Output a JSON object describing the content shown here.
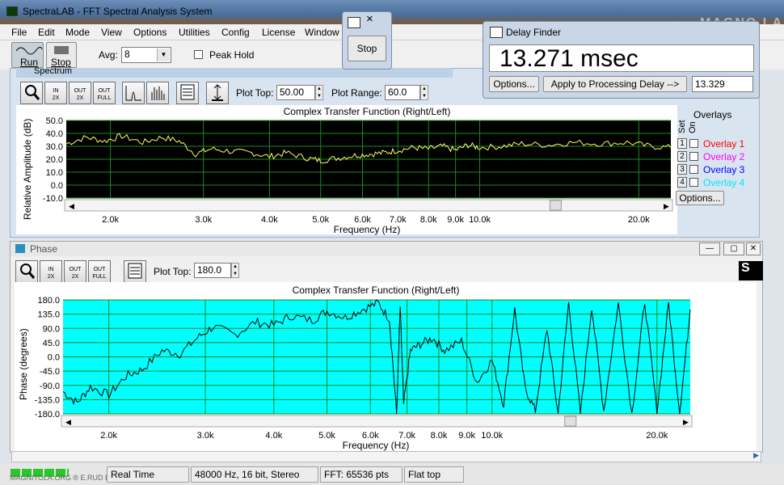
{
  "app": {
    "title": "SpectraLAB - FFT Spectral Analysis System",
    "brand_watermark": "MAGNO LA"
  },
  "menu": [
    "File",
    "Edit",
    "Mode",
    "View",
    "Options",
    "Utilities",
    "Config",
    "License",
    "Window"
  ],
  "toolbar": {
    "run_label": "Run",
    "stop_label": "Stop",
    "avg_label": "Avg:",
    "avg_value": "8",
    "peak_hold_label": "Peak Hold",
    "peak_hold_checked": false
  },
  "stop_dialog": {
    "button_label": "Stop",
    "close_glyph": "×"
  },
  "delay_finder": {
    "title": "Delay Finder",
    "value": "13.271 msec",
    "options_label": "Options...",
    "apply_label": "Apply to Processing Delay -->",
    "delay_value": "13.329"
  },
  "spectrum": {
    "window_title": "Spectrum",
    "plot_top_label": "Plot Top:",
    "plot_top_value": "50.00",
    "plot_range_label": "Plot Range:",
    "plot_range_value": "60.0",
    "tool_icons": [
      "zoom-icon",
      "zoom-in-2x-icon",
      "zoom-out-2x-icon",
      "zoom-out-full-icon",
      "peak-icon",
      "bars-icon",
      "table-icon",
      "autoscale-icon"
    ],
    "zoom_in_text": "IN\n2X",
    "zoom_out_text": "OUT\n2X",
    "zoom_full_text": "OUT\nFULL",
    "overlays_title": "Overlays",
    "set_label": "Set",
    "on_label": "On",
    "overlays": [
      {
        "num": "1",
        "label": "Overlay 1",
        "color": "#ff0000"
      },
      {
        "num": "2",
        "label": "Overlay 2",
        "color": "#ff00ff"
      },
      {
        "num": "3",
        "label": "Overlay 3",
        "color": "#0000ff"
      },
      {
        "num": "4",
        "label": "Overlay 4",
        "color": "#00e5ff"
      }
    ],
    "options_label": "Options..."
  },
  "phase": {
    "window_title": "Phase",
    "plot_top_label": "Plot Top:",
    "plot_top_value": "180.0",
    "tool_icons": [
      "zoom-icon",
      "zoom-in-2x-icon",
      "zoom-out-2x-icon",
      "zoom-out-full-icon",
      "table-icon"
    ],
    "zoom_in_text": "IN\n2X",
    "zoom_out_text": "OUT\n2X",
    "zoom_full_text": "OUT\nFULL",
    "side_glyph": "S"
  },
  "status": {
    "left_text": "MAGNITOLA.ORG ® E.RUD E.NET®",
    "mode": "Real Time",
    "format": "48000 Hz, 16 bit, Stereo",
    "fft": "FFT: 65536 pts",
    "window": "Flat top"
  },
  "chart_data": [
    {
      "type": "line",
      "title": "Complex Transfer Function (Right/Left)",
      "xlabel": "Frequency (Hz)",
      "ylabel": "Relative Amplitude (dB)",
      "x_scale": "log",
      "xlim": [
        1650,
        23000
      ],
      "ylim": [
        -10.0,
        50.0
      ],
      "y_ticks": [
        "50.0",
        "40.0",
        "30.0",
        "20.0",
        "10.0",
        "0.0",
        "-10.0"
      ],
      "x_ticks": [
        {
          "value": 2000,
          "label": "2.0k"
        },
        {
          "value": 3000,
          "label": "3.0k"
        },
        {
          "value": 4000,
          "label": "4.0k"
        },
        {
          "value": 5000,
          "label": "5.0k"
        },
        {
          "value": 6000,
          "label": "6.0k"
        },
        {
          "value": 7000,
          "label": "7.0k"
        },
        {
          "value": 8000,
          "label": "8.0k"
        },
        {
          "value": 9000,
          "label": "9.0k"
        },
        {
          "value": 10000,
          "label": "10.0k"
        },
        {
          "value": 20000,
          "label": "20.0k"
        }
      ],
      "grid": true,
      "background": "#000000",
      "grid_color": "#1e8a1e",
      "series": [
        {
          "color": "#ffff66",
          "x": [
            1650,
            1800,
            1950,
            2100,
            2300,
            2500,
            2700,
            2900,
            3100,
            3400,
            3700,
            4000,
            4300,
            4700,
            5000,
            5400,
            5800,
            6200,
            6600,
            7000,
            7500,
            8000,
            8500,
            9000,
            9500,
            10000,
            11000,
            12000,
            13500,
            15000,
            17000,
            19000,
            21000,
            23000
          ],
          "y": [
            32,
            37,
            34,
            38,
            33,
            37,
            34,
            24,
            28,
            26,
            25,
            22,
            25,
            21,
            19,
            21,
            23,
            24,
            25,
            27,
            29,
            28,
            30,
            27,
            31,
            29,
            30,
            32,
            31,
            33,
            32,
            33,
            30,
            29
          ]
        }
      ]
    },
    {
      "type": "line",
      "title": "Complex Transfer Function (Right/Left)",
      "xlabel": "Frequency (Hz)",
      "ylabel": "Phase (degrees)",
      "x_scale": "log",
      "xlim": [
        1650,
        23000
      ],
      "ylim": [
        -180.0,
        180.0
      ],
      "y_ticks": [
        "180.0",
        "135.0",
        "90.0",
        "45.0",
        "0.0",
        "-45.0",
        "-90.0",
        "-135.0",
        "-180.0"
      ],
      "x_ticks": [
        {
          "value": 2000,
          "label": "2.0k"
        },
        {
          "value": 3000,
          "label": "3.0k"
        },
        {
          "value": 4000,
          "label": "4.0k"
        },
        {
          "value": 5000,
          "label": "5.0k"
        },
        {
          "value": 6000,
          "label": "6.0k"
        },
        {
          "value": 7000,
          "label": "7.0k"
        },
        {
          "value": 8000,
          "label": "8.0k"
        },
        {
          "value": 9000,
          "label": "9.0k"
        },
        {
          "value": 10000,
          "label": "10.0k"
        },
        {
          "value": 20000,
          "label": "20.0k"
        }
      ],
      "grid": true,
      "background": "#00ffff",
      "grid_color": "#1e8a1e",
      "series": [
        {
          "color": "#000000",
          "x": [
            1650,
            1750,
            1850,
            2000,
            2150,
            2300,
            2500,
            2700,
            2900,
            3100,
            3400,
            3700,
            4000,
            4300,
            4700,
            5000,
            5400,
            5800,
            6200,
            6500,
            6700,
            6800,
            6900,
            7100,
            7400,
            7800,
            8200,
            8800,
            9400,
            10000,
            10500,
            11000,
            11500,
            12000,
            12600,
            13200,
            13800,
            14500,
            15200,
            16000,
            17000,
            18000,
            19000,
            20000,
            21000,
            22000,
            23000
          ],
          "y": [
            -110,
            -145,
            -95,
            -120,
            -60,
            -40,
            20,
            10,
            60,
            95,
            70,
            110,
            100,
            130,
            115,
            145,
            125,
            150,
            170,
            120,
            -180,
            160,
            -150,
            20,
            40,
            60,
            20,
            50,
            -80,
            -10,
            -150,
            150,
            -100,
            -170,
            90,
            -180,
            170,
            -180,
            160,
            -170,
            170,
            -180,
            175,
            -175,
            170,
            -180,
            150
          ]
        }
      ]
    }
  ]
}
